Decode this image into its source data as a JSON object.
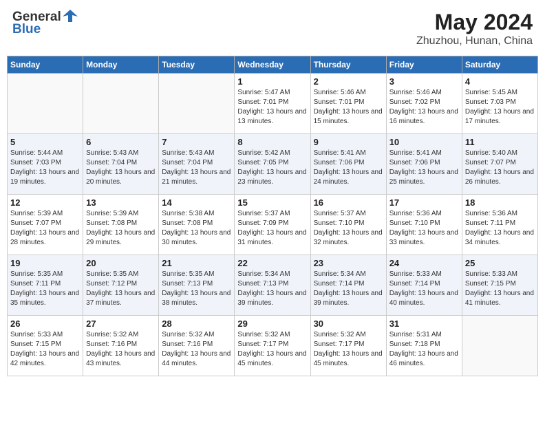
{
  "header": {
    "logo_general": "General",
    "logo_blue": "Blue",
    "month": "May 2024",
    "location": "Zhuzhou, Hunan, China"
  },
  "days_of_week": [
    "Sunday",
    "Monday",
    "Tuesday",
    "Wednesday",
    "Thursday",
    "Friday",
    "Saturday"
  ],
  "weeks": [
    [
      {
        "day": "",
        "info": ""
      },
      {
        "day": "",
        "info": ""
      },
      {
        "day": "",
        "info": ""
      },
      {
        "day": "1",
        "info": "Sunrise: 5:47 AM\nSunset: 7:01 PM\nDaylight: 13 hours and 13 minutes."
      },
      {
        "day": "2",
        "info": "Sunrise: 5:46 AM\nSunset: 7:01 PM\nDaylight: 13 hours and 15 minutes."
      },
      {
        "day": "3",
        "info": "Sunrise: 5:46 AM\nSunset: 7:02 PM\nDaylight: 13 hours and 16 minutes."
      },
      {
        "day": "4",
        "info": "Sunrise: 5:45 AM\nSunset: 7:03 PM\nDaylight: 13 hours and 17 minutes."
      }
    ],
    [
      {
        "day": "5",
        "info": "Sunrise: 5:44 AM\nSunset: 7:03 PM\nDaylight: 13 hours and 19 minutes."
      },
      {
        "day": "6",
        "info": "Sunrise: 5:43 AM\nSunset: 7:04 PM\nDaylight: 13 hours and 20 minutes."
      },
      {
        "day": "7",
        "info": "Sunrise: 5:43 AM\nSunset: 7:04 PM\nDaylight: 13 hours and 21 minutes."
      },
      {
        "day": "8",
        "info": "Sunrise: 5:42 AM\nSunset: 7:05 PM\nDaylight: 13 hours and 23 minutes."
      },
      {
        "day": "9",
        "info": "Sunrise: 5:41 AM\nSunset: 7:06 PM\nDaylight: 13 hours and 24 minutes."
      },
      {
        "day": "10",
        "info": "Sunrise: 5:41 AM\nSunset: 7:06 PM\nDaylight: 13 hours and 25 minutes."
      },
      {
        "day": "11",
        "info": "Sunrise: 5:40 AM\nSunset: 7:07 PM\nDaylight: 13 hours and 26 minutes."
      }
    ],
    [
      {
        "day": "12",
        "info": "Sunrise: 5:39 AM\nSunset: 7:07 PM\nDaylight: 13 hours and 28 minutes."
      },
      {
        "day": "13",
        "info": "Sunrise: 5:39 AM\nSunset: 7:08 PM\nDaylight: 13 hours and 29 minutes."
      },
      {
        "day": "14",
        "info": "Sunrise: 5:38 AM\nSunset: 7:08 PM\nDaylight: 13 hours and 30 minutes."
      },
      {
        "day": "15",
        "info": "Sunrise: 5:37 AM\nSunset: 7:09 PM\nDaylight: 13 hours and 31 minutes."
      },
      {
        "day": "16",
        "info": "Sunrise: 5:37 AM\nSunset: 7:10 PM\nDaylight: 13 hours and 32 minutes."
      },
      {
        "day": "17",
        "info": "Sunrise: 5:36 AM\nSunset: 7:10 PM\nDaylight: 13 hours and 33 minutes."
      },
      {
        "day": "18",
        "info": "Sunrise: 5:36 AM\nSunset: 7:11 PM\nDaylight: 13 hours and 34 minutes."
      }
    ],
    [
      {
        "day": "19",
        "info": "Sunrise: 5:35 AM\nSunset: 7:11 PM\nDaylight: 13 hours and 35 minutes."
      },
      {
        "day": "20",
        "info": "Sunrise: 5:35 AM\nSunset: 7:12 PM\nDaylight: 13 hours and 37 minutes."
      },
      {
        "day": "21",
        "info": "Sunrise: 5:35 AM\nSunset: 7:13 PM\nDaylight: 13 hours and 38 minutes."
      },
      {
        "day": "22",
        "info": "Sunrise: 5:34 AM\nSunset: 7:13 PM\nDaylight: 13 hours and 39 minutes."
      },
      {
        "day": "23",
        "info": "Sunrise: 5:34 AM\nSunset: 7:14 PM\nDaylight: 13 hours and 39 minutes."
      },
      {
        "day": "24",
        "info": "Sunrise: 5:33 AM\nSunset: 7:14 PM\nDaylight: 13 hours and 40 minutes."
      },
      {
        "day": "25",
        "info": "Sunrise: 5:33 AM\nSunset: 7:15 PM\nDaylight: 13 hours and 41 minutes."
      }
    ],
    [
      {
        "day": "26",
        "info": "Sunrise: 5:33 AM\nSunset: 7:15 PM\nDaylight: 13 hours and 42 minutes."
      },
      {
        "day": "27",
        "info": "Sunrise: 5:32 AM\nSunset: 7:16 PM\nDaylight: 13 hours and 43 minutes."
      },
      {
        "day": "28",
        "info": "Sunrise: 5:32 AM\nSunset: 7:16 PM\nDaylight: 13 hours and 44 minutes."
      },
      {
        "day": "29",
        "info": "Sunrise: 5:32 AM\nSunset: 7:17 PM\nDaylight: 13 hours and 45 minutes."
      },
      {
        "day": "30",
        "info": "Sunrise: 5:32 AM\nSunset: 7:17 PM\nDaylight: 13 hours and 45 minutes."
      },
      {
        "day": "31",
        "info": "Sunrise: 5:31 AM\nSunset: 7:18 PM\nDaylight: 13 hours and 46 minutes."
      },
      {
        "day": "",
        "info": ""
      }
    ]
  ]
}
